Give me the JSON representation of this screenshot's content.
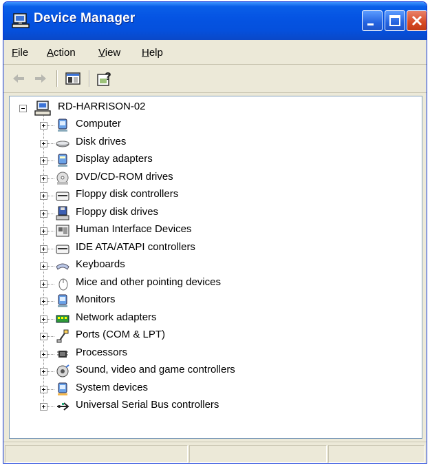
{
  "window": {
    "title": "Device Manager",
    "accent_color": "#0554e3",
    "close_color": "#d74a25"
  },
  "menu": {
    "items": [
      {
        "label": "File",
        "mnemonic": "F",
        "rest": "ile"
      },
      {
        "label": "Action",
        "mnemonic": "A",
        "rest": "ction"
      },
      {
        "label": "View",
        "mnemonic": "V",
        "rest": "iew"
      },
      {
        "label": "Help",
        "mnemonic": "H",
        "rest": "elp"
      }
    ]
  },
  "toolbar": {
    "buttons": [
      "back-arrow-icon",
      "forward-arrow-icon",
      "show-hide-console-tree-icon",
      "help-icon"
    ]
  },
  "tree": {
    "root": {
      "label": "RD-HARRISON-02",
      "icon": "computer-icon"
    },
    "items": [
      {
        "label": "Computer",
        "icon": "computer-icon"
      },
      {
        "label": "Disk drives",
        "icon": "disk-drive-icon"
      },
      {
        "label": "Display adapters",
        "icon": "display-adapter-icon"
      },
      {
        "label": "DVD/CD-ROM drives",
        "icon": "cdrom-icon"
      },
      {
        "label": "Floppy disk controllers",
        "icon": "controller-icon"
      },
      {
        "label": "Floppy disk drives",
        "icon": "floppy-icon"
      },
      {
        "label": "Human Interface Devices",
        "icon": "hid-icon"
      },
      {
        "label": "IDE ATA/ATAPI controllers",
        "icon": "ide-controller-icon"
      },
      {
        "label": "Keyboards",
        "icon": "keyboard-icon"
      },
      {
        "label": "Mice and other pointing devices",
        "icon": "mouse-icon"
      },
      {
        "label": "Monitors",
        "icon": "monitor-icon"
      },
      {
        "label": "Network adapters",
        "icon": "network-adapter-icon"
      },
      {
        "label": "Ports (COM & LPT)",
        "icon": "port-icon"
      },
      {
        "label": "Processors",
        "icon": "processor-icon"
      },
      {
        "label": "Sound, video and game controllers",
        "icon": "sound-icon"
      },
      {
        "label": "System devices",
        "icon": "system-device-icon"
      },
      {
        "label": "Universal Serial Bus controllers",
        "icon": "usb-icon"
      }
    ]
  }
}
